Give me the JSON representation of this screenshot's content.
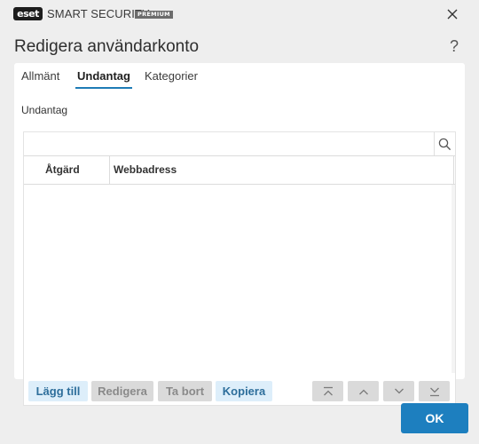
{
  "app": {
    "logo_text": "eset",
    "product_name": "SMART SECURITY",
    "edition": "PREMIUM"
  },
  "dialog": {
    "title": "Redigera användarkonto",
    "help_label": "?"
  },
  "tabs": [
    {
      "label": "Allmänt",
      "active": false
    },
    {
      "label": "Undantag",
      "active": true
    },
    {
      "label": "Kategorier",
      "active": false
    }
  ],
  "section": {
    "label": "Undantag"
  },
  "search": {
    "value": "",
    "placeholder": ""
  },
  "table": {
    "columns": [
      "Åtgärd",
      "Webbadress"
    ],
    "rows": []
  },
  "actions": {
    "add": "Lägg till",
    "edit": "Redigera",
    "remove": "Ta bort",
    "copy": "Kopiera"
  },
  "footer": {
    "ok_label": "OK"
  },
  "icons": {
    "close": "close-icon",
    "search": "search-icon",
    "move_top": "move-top-icon",
    "move_up": "chevron-up-icon",
    "move_down": "chevron-down-icon",
    "move_bottom": "move-bottom-icon"
  },
  "colors": {
    "accent": "#1d7fbf",
    "tab_underline": "#1e7cb6",
    "enabled_button_bg": "#ddeefa",
    "disabled_button_bg": "#dadada"
  }
}
